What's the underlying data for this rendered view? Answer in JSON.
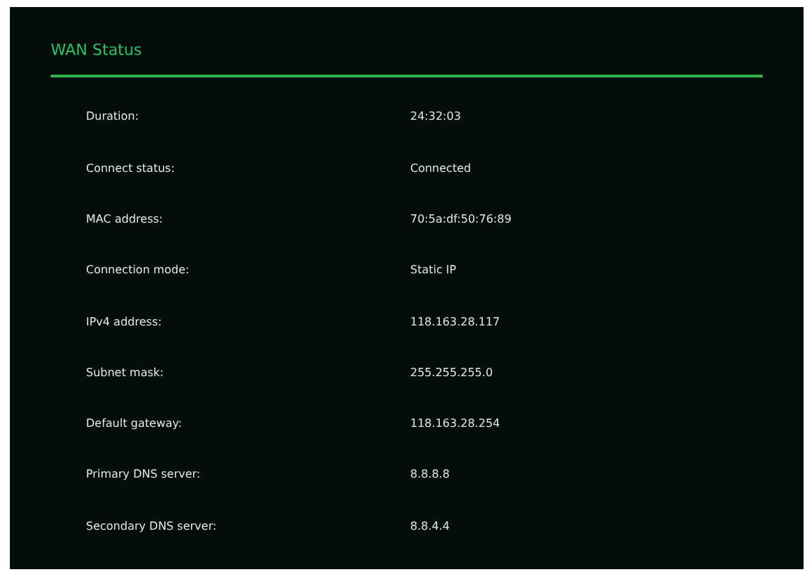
{
  "title": "WAN Status",
  "rows": [
    {
      "label": "Duration:",
      "value": "24:32:03"
    },
    {
      "label": "Connect status:",
      "value": "Connected"
    },
    {
      "label": "MAC address:",
      "value": "70:5a:df:50:76:89"
    },
    {
      "label": "Connection mode:",
      "value": "Static IP"
    },
    {
      "label": "IPv4 address:",
      "value": "118.163.28.117"
    },
    {
      "label": "Subnet mask:",
      "value": "255.255.255.0"
    },
    {
      "label": "Default gateway:",
      "value": "118.163.28.254"
    },
    {
      "label": "Primary DNS server:",
      "value": "8.8.8.8"
    },
    {
      "label": "Secondary DNS server:",
      "value": "8.8.4.4"
    }
  ]
}
